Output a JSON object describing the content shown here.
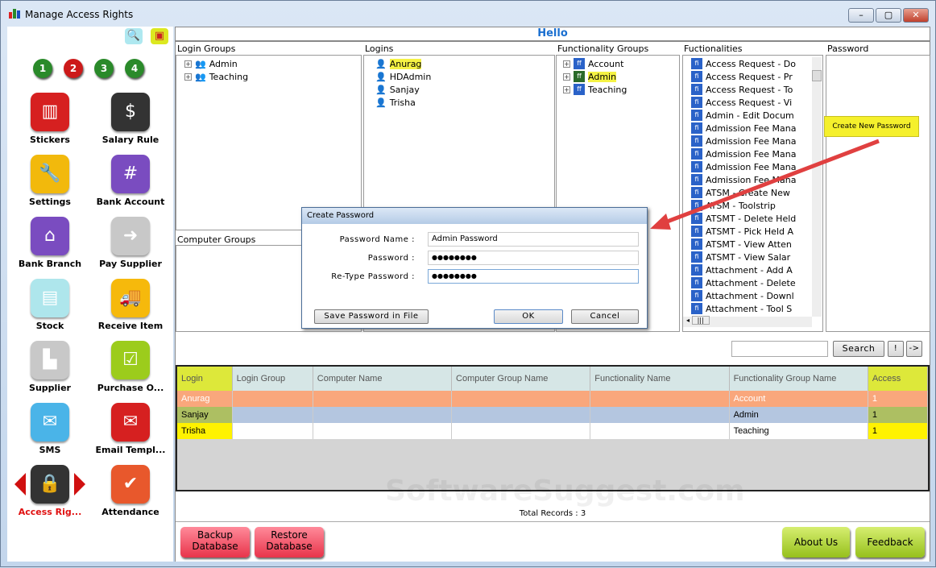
{
  "window": {
    "title": "Manage Access Rights"
  },
  "sidebar": {
    "numbers": [
      "1",
      "2",
      "3",
      "4"
    ],
    "tiles": [
      {
        "label": "Stickers",
        "icon": "barcode-icon",
        "color": "#d62020"
      },
      {
        "label": "Salary Rule",
        "icon": "dollar-icon",
        "color": "#333333"
      },
      {
        "label": "Settings",
        "icon": "tools-icon",
        "color": "#f2b90c"
      },
      {
        "label": "Bank Account",
        "icon": "bank-card-icon",
        "color": "#7a4cc0"
      },
      {
        "label": "Bank Branch",
        "icon": "bank-building-icon",
        "color": "#7a4cc0"
      },
      {
        "label": "Pay Supplier",
        "icon": "factory-arrow-icon",
        "color": "#c8c8c8"
      },
      {
        "label": "Stock",
        "icon": "trolley-icon",
        "color": "#aee6ec"
      },
      {
        "label": "Receive Item",
        "icon": "truck-icon",
        "color": "#f6b90c"
      },
      {
        "label": "Supplier",
        "icon": "factory-icon",
        "color": "#c8c8c8"
      },
      {
        "label": "Purchase O...",
        "icon": "checklist-icon",
        "color": "#9ccc1c"
      },
      {
        "label": "SMS",
        "icon": "phone-mail-icon",
        "color": "#4ab4e8"
      },
      {
        "label": "Email Templ...",
        "icon": "envelope-icon",
        "color": "#d62020"
      },
      {
        "label": "Access Rig...",
        "icon": "lock-key-icon",
        "color": "#333333"
      },
      {
        "label": "Attendance",
        "icon": "calendar-check-icon",
        "color": "#e8582c"
      }
    ]
  },
  "header": {
    "title": "Hello"
  },
  "panels": {
    "login_groups": {
      "label": "Login Groups",
      "items": [
        "Admin",
        "Teaching"
      ]
    },
    "logins": {
      "label": "Logins",
      "items": [
        "Anurag",
        "HDAdmin",
        "Sanjay",
        "Trisha"
      ],
      "selected": "Anurag"
    },
    "functionality_groups": {
      "label": "Functionality Groups",
      "items": [
        "Account",
        "Admin",
        "Teaching"
      ],
      "selected": "Admin"
    },
    "functionalities": {
      "label": "Fuctionalities",
      "items": [
        "Access Request - Do",
        "Access Request - Pr",
        "Access Request - To",
        "Access Request - Vi",
        "Admin - Edit Docum",
        "Admission Fee Mana",
        "Admission Fee Mana",
        "Admission Fee Mana",
        "Admission Fee Mana",
        "Admission Fee Mana",
        "ATSM - Create New",
        "ATSM - Toolstrip",
        "ATSMT - Delete Held",
        "ATSMT - Pick Held A",
        "ATSMT - View Atten",
        "ATSMT - View Salar",
        "Attachment - Add A",
        "Attachment - Delete",
        "Attachment - Downl",
        "Attachment - Tool S"
      ]
    },
    "password": {
      "label": "Password",
      "create_button": "Create New Password"
    },
    "computer_groups": {
      "label": "Computer Groups"
    }
  },
  "dialog": {
    "title": "Create Password",
    "password_name_label": "Password Name :",
    "password_name_value": "Admin Password",
    "password_label": "Password :",
    "password_value": "●●●●●●●●",
    "retype_label": "Re-Type Password :",
    "retype_value": "●●●●●●●●",
    "save_file": "Save Password in File",
    "ok": "OK",
    "cancel": "Cancel"
  },
  "search": {
    "value": "",
    "button": "Search",
    "bang": "!",
    "next": "->"
  },
  "grid": {
    "columns": [
      "Login",
      "Login Group",
      "Computer Name",
      "Computer Group Name",
      "Functionality Name",
      "Functionality Group Name",
      "Access"
    ],
    "rows": [
      [
        "Anurag",
        "",
        "",
        "",
        "",
        "Account",
        "1"
      ],
      [
        "Sanjay",
        "",
        "",
        "",
        "",
        "Admin",
        "1"
      ],
      [
        "Trisha",
        "",
        "",
        "",
        "",
        "Teaching",
        "1"
      ]
    ],
    "total": "Total Records : 3"
  },
  "footer": {
    "backup": "Backup Database",
    "restore": "Restore Database",
    "about": "About Us",
    "feedback": "Feedback"
  },
  "watermark": "SoftwareSuggest.com"
}
